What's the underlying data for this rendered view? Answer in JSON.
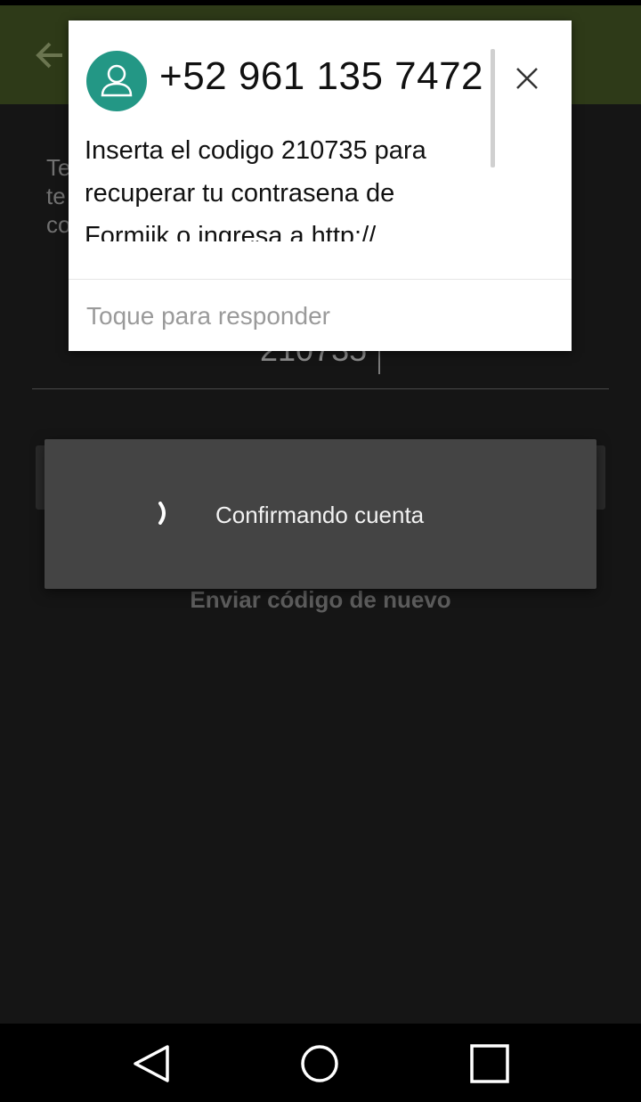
{
  "background": {
    "partial_text": [
      "Te",
      "te",
      "co"
    ],
    "code_value": "210735",
    "resend_link": "Enviar código de nuevo"
  },
  "notification": {
    "sender": "+52 961 135 7472",
    "message": "Inserta el codigo 210735 para recuperar tu contrasena de Formiik o ingresa a  http://",
    "reply_hint": "Toque para responder",
    "avatar_color": "#239785"
  },
  "dialog": {
    "text": "Confirmando cuenta"
  },
  "nav": {
    "icons": [
      "back-triangle-icon",
      "home-circle-icon",
      "recents-square-icon"
    ]
  }
}
